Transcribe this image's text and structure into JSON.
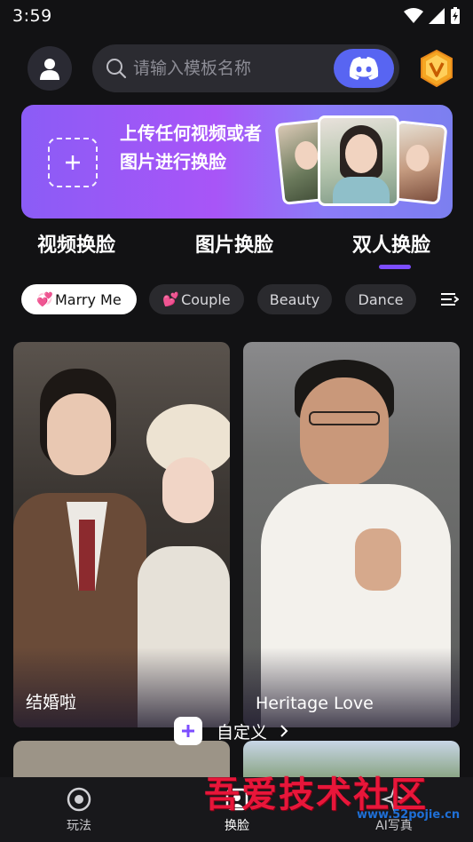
{
  "status": {
    "time": "3:59"
  },
  "header": {
    "search_placeholder": "请输入模板名称"
  },
  "banner": {
    "text": "上传任何视频或者图片进行换脸"
  },
  "tabs": [
    {
      "label": "视频换脸",
      "active": false
    },
    {
      "label": "图片换脸",
      "active": false
    },
    {
      "label": "双人换脸",
      "active": true
    }
  ],
  "chips": [
    {
      "emoji": "💞",
      "label": "Marry Me",
      "active": true
    },
    {
      "emoji": "💕",
      "label": "Couple",
      "active": false
    },
    {
      "emoji": "",
      "label": "Beauty",
      "active": false
    },
    {
      "emoji": "",
      "label": "Dance",
      "active": false
    }
  ],
  "cards": [
    {
      "title": "结婚啦"
    },
    {
      "title": "Heritage Love"
    }
  ],
  "custom_button": {
    "label": "自定义"
  },
  "bottom_nav": [
    {
      "label": "玩法",
      "icon": "target-icon"
    },
    {
      "label": "换脸",
      "icon": "face-swap-icon"
    },
    {
      "label": "AI写真",
      "icon": "ai-photo-icon"
    }
  ],
  "watermark": {
    "text": "吾爱技术社区",
    "url": "www.52pojie.cn"
  },
  "colors": {
    "accent": "#7c4dff",
    "discord": "#5865f2",
    "banner_start": "#8b5cf6",
    "banner_end": "#7c7ff0",
    "background": "#121214"
  }
}
